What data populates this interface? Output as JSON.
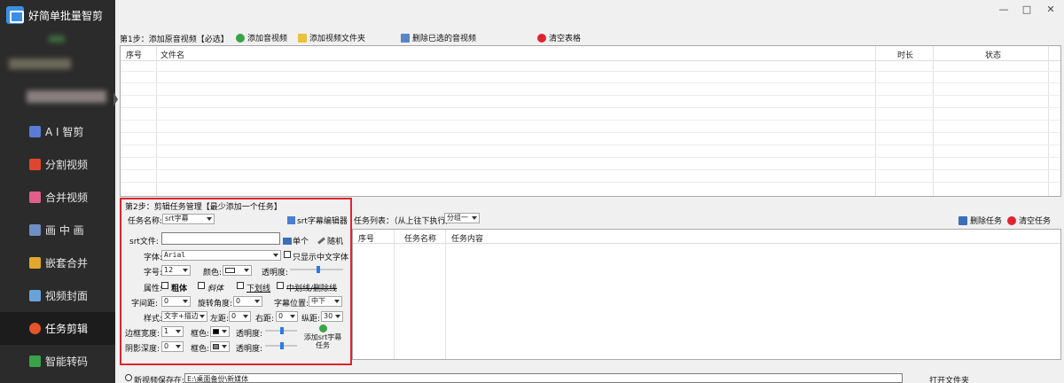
{
  "app": {
    "title": "好简单批量智剪"
  },
  "window": {
    "minimize": "—",
    "maximize": "□",
    "close": "✕"
  },
  "sidebar": {
    "items": [
      {
        "label": "A I 智剪",
        "icon": "ai-edit-icon",
        "color": "#5b7bd6",
        "active": false
      },
      {
        "label": "分割视频",
        "icon": "split-video-icon",
        "color": "#e0462f",
        "active": false
      },
      {
        "label": "合并视频",
        "icon": "merge-video-icon",
        "color": "#e05f8a",
        "active": false
      },
      {
        "label": "画 中 画",
        "icon": "picture-in-picture-icon",
        "color": "#6f8fc4",
        "active": false
      },
      {
        "label": "嵌套合并",
        "icon": "nested-merge-icon",
        "color": "#e3a82b",
        "active": false
      },
      {
        "label": "视频封面",
        "icon": "video-cover-icon",
        "color": "#6aa3d9",
        "active": false
      },
      {
        "label": "任务剪辑",
        "icon": "task-edit-icon",
        "color": "#e8552a",
        "active": true
      },
      {
        "label": "智能转码",
        "icon": "smart-transcode-icon",
        "color": "#3aa34a",
        "active": false
      }
    ]
  },
  "step1": {
    "title": "第1步：添加原音视频【必选】",
    "add_av": "添加音视频",
    "add_folder": "添加视频文件夹",
    "delete_selected": "删除已选的音视频",
    "clear_table": "清空表格"
  },
  "file_table": {
    "columns": [
      "序号",
      "文件名",
      "时长",
      "状态"
    ]
  },
  "step2": {
    "title": "第2步：剪辑任务管理【最少添加一个任务】",
    "task_name_label": "任务名称:",
    "task_name_value": "srt字幕",
    "srt_editor": "srt字幕编辑器",
    "srt_file_label": "srt文件:",
    "srt_file_value": "",
    "single": "单个",
    "random": "随机",
    "font_label": "字体:",
    "font_value": "Arial",
    "only_chinese": "只显示中文字体",
    "size_label": "字号:",
    "size_value": "12",
    "color_label": "颜色:",
    "opacity_label": "透明度:",
    "attr_label": "属性:",
    "bold": "粗体",
    "italic": "斜体",
    "underline": "下划线",
    "strike": "中划线/删除线",
    "spacing_label": "字间距:",
    "spacing_value": "0",
    "rotate_label": "旋转角度:",
    "rotate_value": "0",
    "position_label": "字幕位置:",
    "position_value": "中下",
    "style_label": "样式:",
    "style_value": "文字+描边",
    "left_label": "左距:",
    "left_value": "0",
    "right_label": "右距:",
    "right_value": "0",
    "vmargin_label": "纵距:",
    "vmargin_value": "30",
    "border_label": "边框宽度:",
    "border_value": "1",
    "border_color_label": "框色:",
    "border_opacity_label": "透明度:",
    "shadow_label": "阴影深度:",
    "shadow_value": "0",
    "shadow_color_label": "框色:",
    "shadow_opacity_label": "透明度:",
    "add_task": "添加srt字幕任务",
    "text_color": "#ffffff",
    "border_color": "#000000",
    "shadow_color": "#808080"
  },
  "task_list": {
    "title": "任务列表：（从上往下执行）",
    "group_value": "分组一",
    "delete_task": "删除任务",
    "clear_task": "清空任务",
    "columns": [
      "序号",
      "任务名称",
      "任务内容"
    ]
  },
  "bottom": {
    "save_label": "新视频保存在:",
    "path_value": "E:\\桌面备份\\新媒体",
    "open_folder": "打开文件夹"
  }
}
